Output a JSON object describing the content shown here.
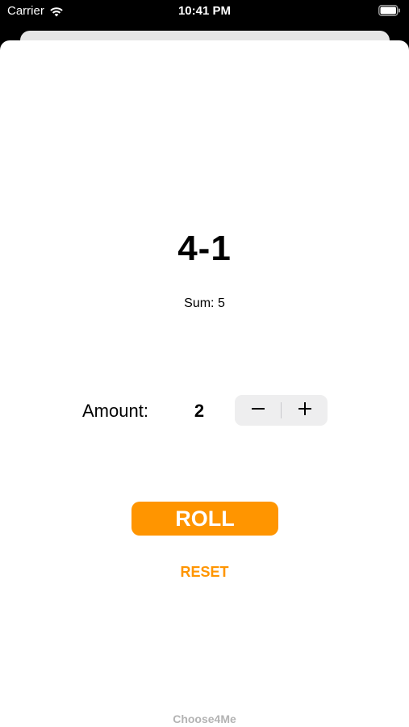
{
  "status_bar": {
    "carrier": "Carrier",
    "time": "10:41 PM",
    "wifi_icon": "wifi-icon",
    "battery_icon": "battery-icon",
    "text_color": "#ffffff",
    "background": "#000000"
  },
  "dice": {
    "result": "4-1",
    "sum": "Sum: 5"
  },
  "amount": {
    "label": "Amount:",
    "value": "2",
    "decrement_icon": "minus-icon",
    "increment_icon": "plus-icon"
  },
  "actions": {
    "roll_label": "ROLL",
    "reset_label": "RESET",
    "accent_color": "#ff9500"
  },
  "footer": {
    "app_name": "Choose4Me"
  }
}
